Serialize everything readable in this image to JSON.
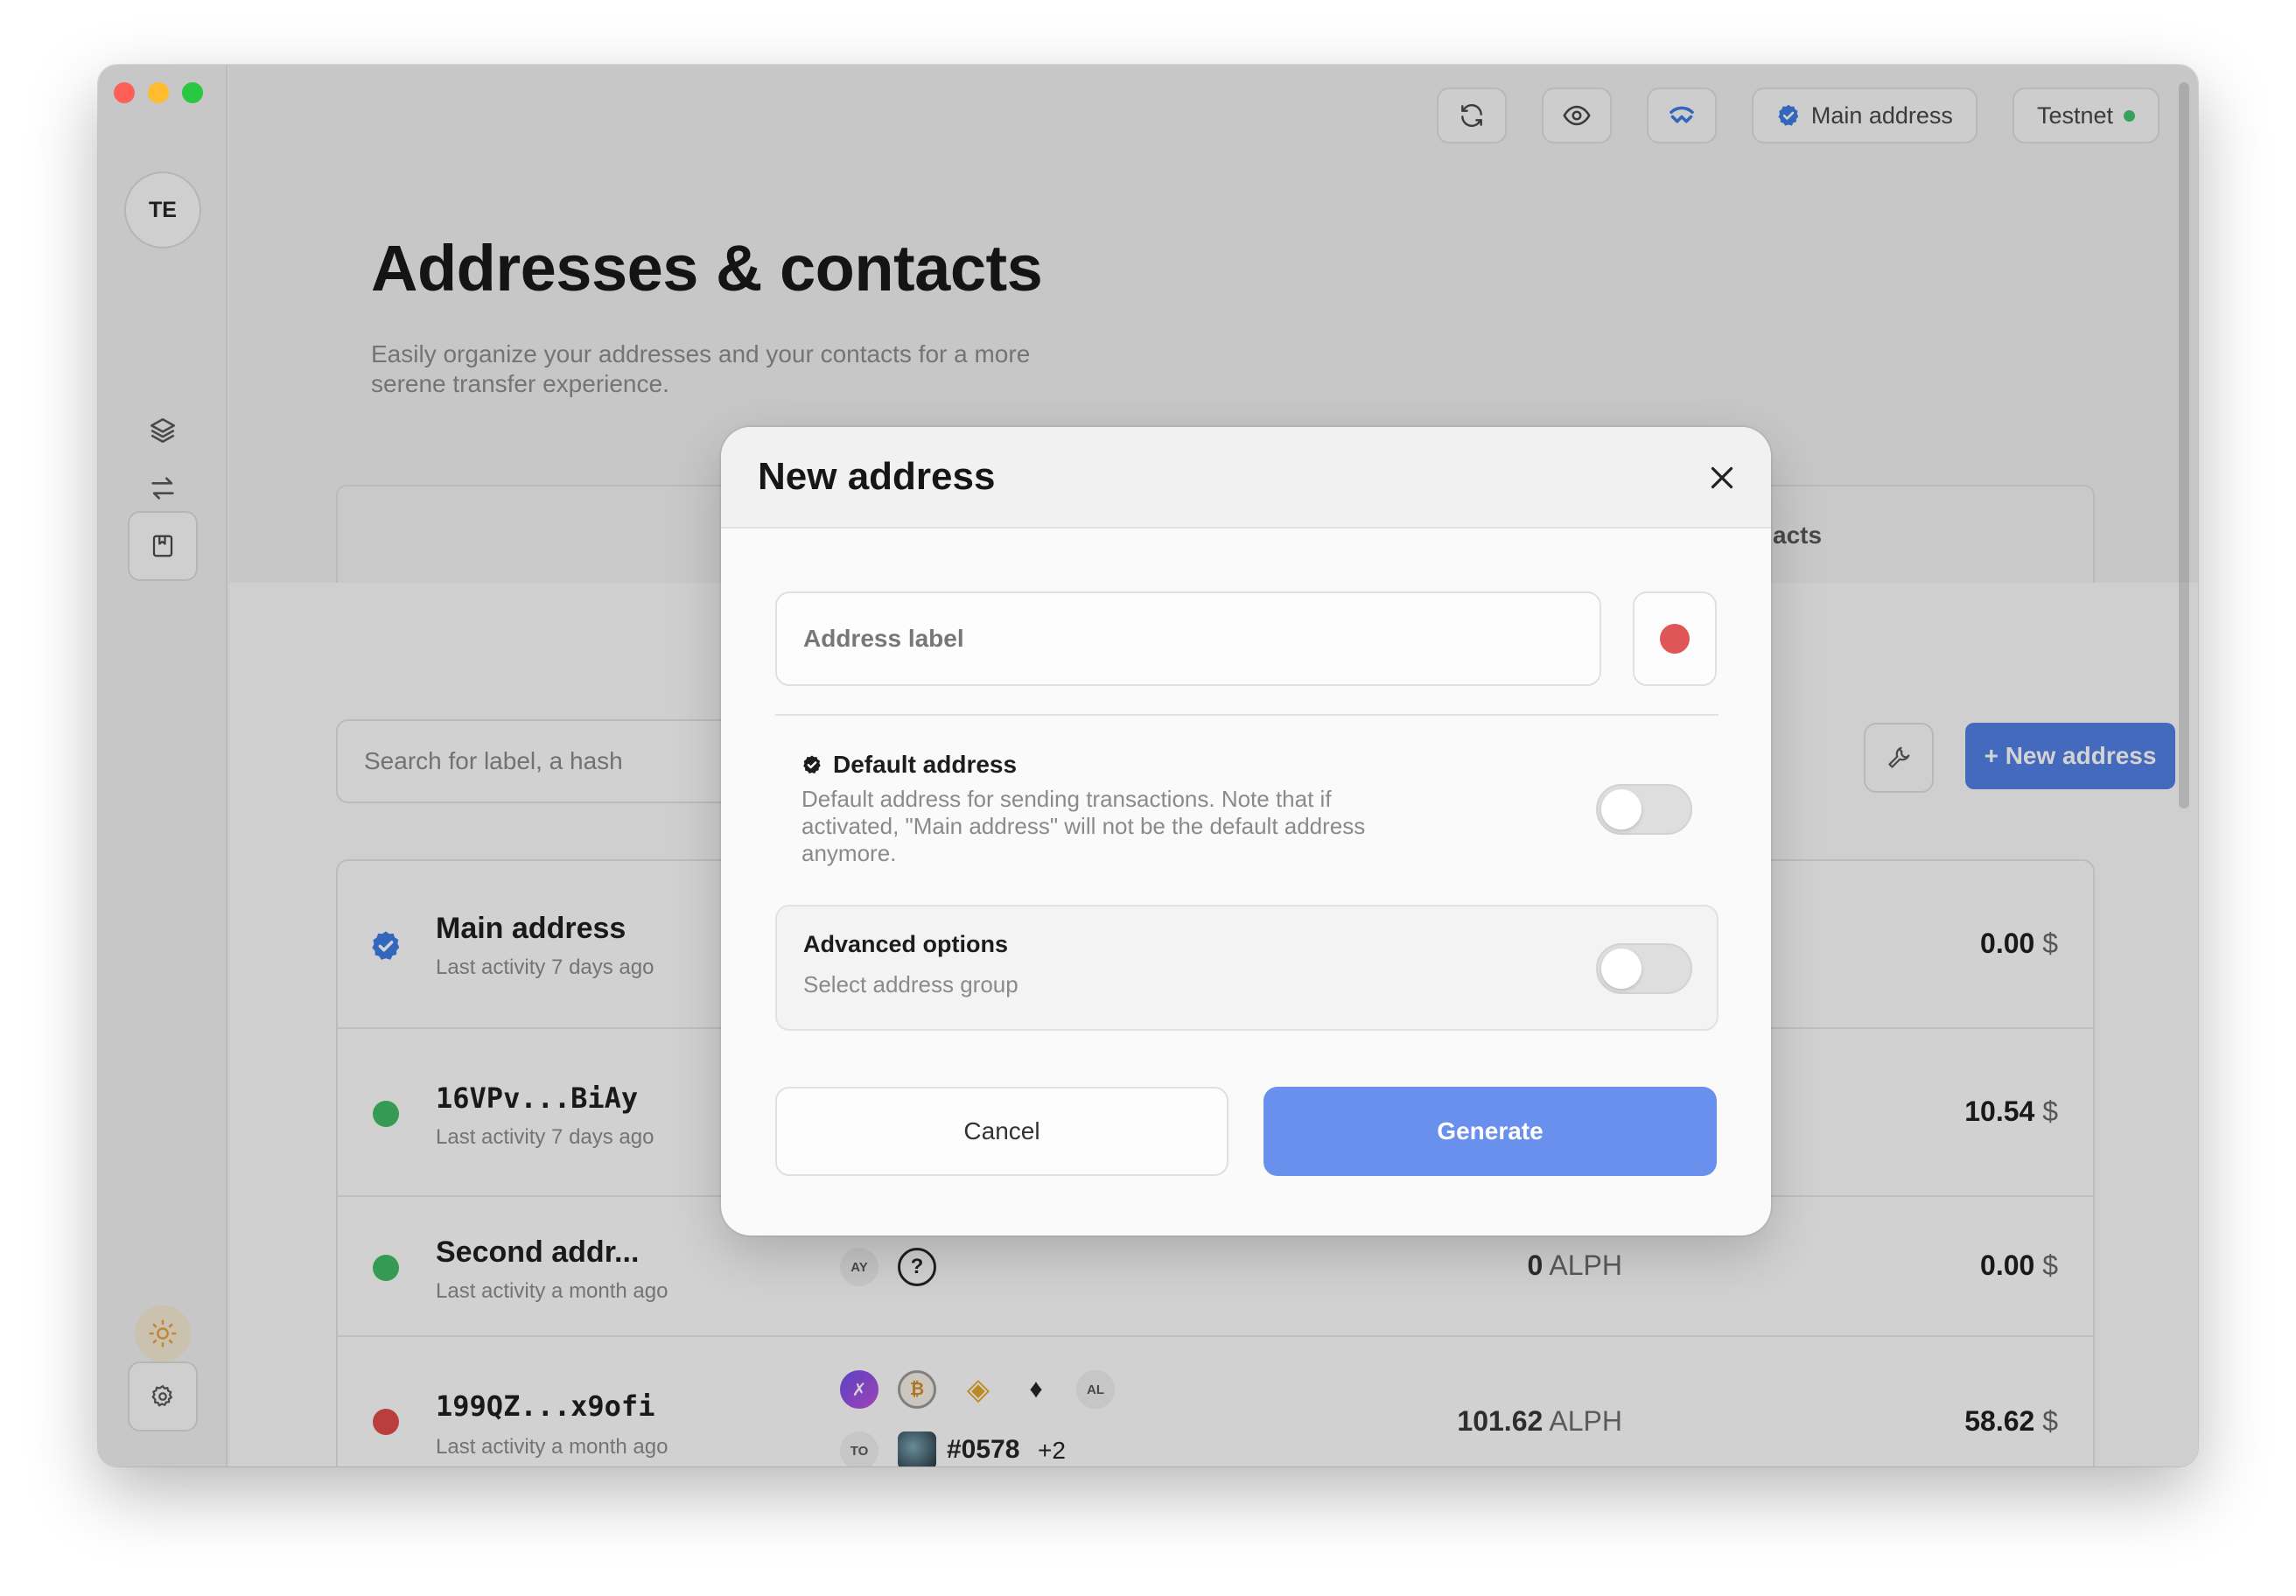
{
  "topbar": {
    "main_address_label": "Main address",
    "network_label": "Testnet"
  },
  "sidebar": {
    "avatar_initials": "TE"
  },
  "page": {
    "title": "Addresses & contacts",
    "subtitle": "Easily organize your addresses and your contacts for a more serene transfer experience.",
    "tab_contacts": "acts"
  },
  "toolbar": {
    "search_placeholder": "Search for label, a hash",
    "new_address_label": "+ New address"
  },
  "addresses": [
    {
      "name": "Main address",
      "activity": "Last activity 7 days ago",
      "alph": "",
      "usd": "0.00",
      "dot_color": "#3b7be3"
    },
    {
      "name": "16VPv...BiAy",
      "activity": "Last activity 7 days ago",
      "alph": "",
      "usd": "10.54",
      "dot_color": "#3dbb63"
    },
    {
      "name": "Second addr...",
      "activity": "Last activity a month ago",
      "alph": "0",
      "alph_unit": "ALPH",
      "usd": "0.00",
      "dot_color": "#3dbb63"
    },
    {
      "name": "199QZ...x9ofi",
      "activity": "Last activity a month ago",
      "alph": "101.62",
      "alph_unit": "ALPH",
      "usd": "58.62",
      "dot_color": "#e04848"
    }
  ],
  "row3_tokens": {
    "ay": "AY"
  },
  "row4_tokens": {
    "al": "AL",
    "to": "TO",
    "nft": "#0578",
    "more": "+2"
  },
  "currency_symbol": "$",
  "modal": {
    "title": "New address",
    "label_placeholder": "Address label",
    "color": "#e05555",
    "default_title": "Default address",
    "default_desc": "Default address for sending transactions. Note that if activated, \"Main address\" will not be the default address anymore.",
    "advanced_title": "Advanced options",
    "advanced_sub": "Select address group",
    "cancel_label": "Cancel",
    "generate_label": "Generate"
  }
}
